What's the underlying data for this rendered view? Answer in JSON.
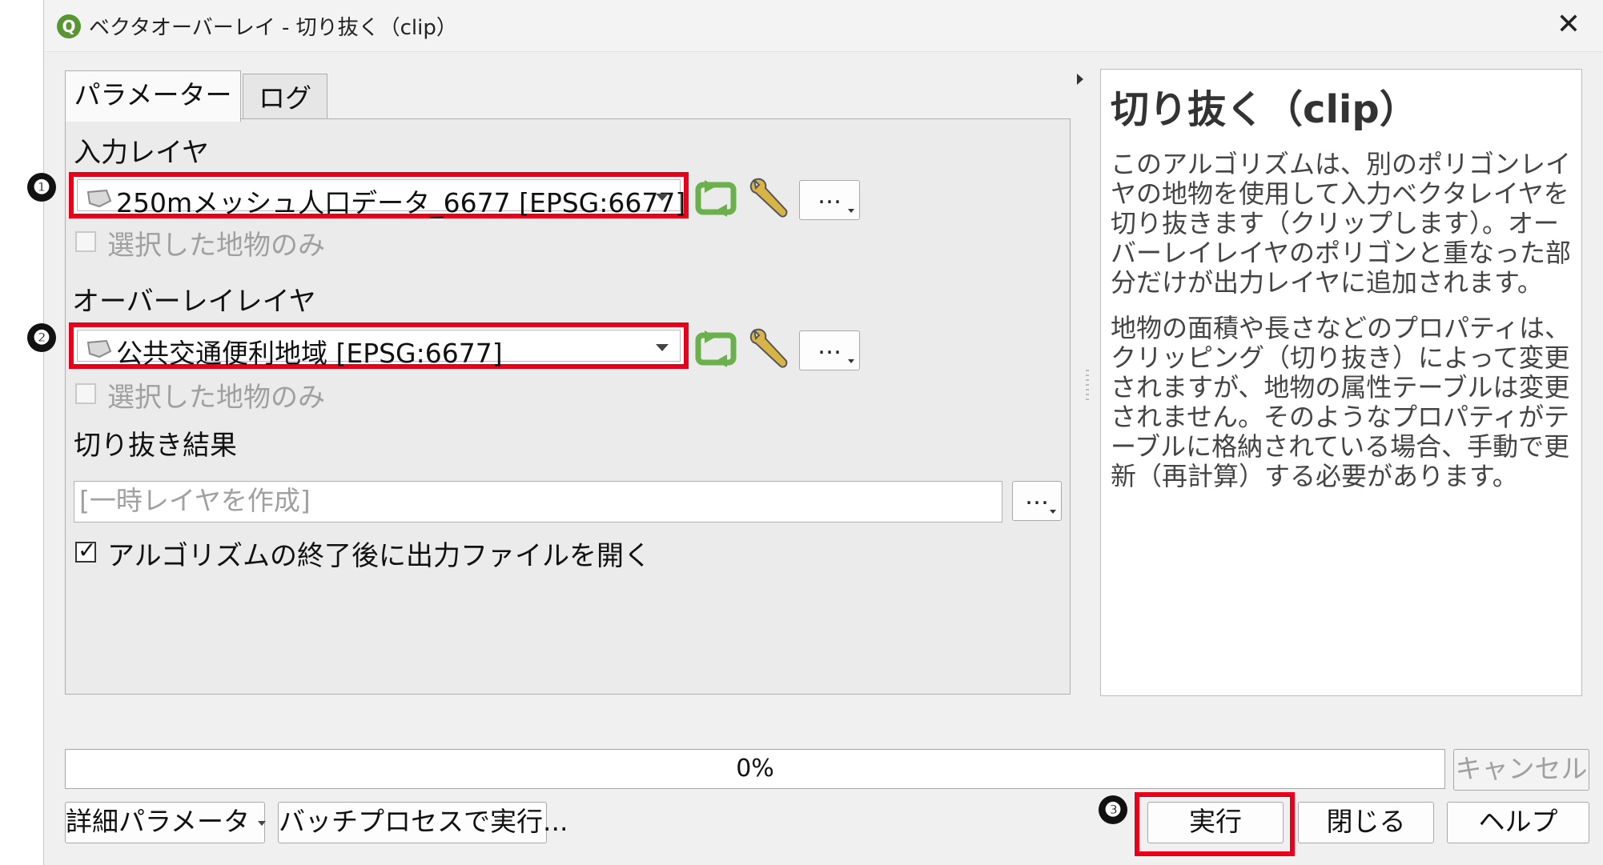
{
  "window": {
    "title": "ベクタオーバーレイ - 切り抜く（clip）",
    "close_glyph": "✕",
    "app_icon_letter": "Q"
  },
  "tabs": [
    {
      "label": "パラメーター",
      "active": true
    },
    {
      "label": "ログ",
      "active": false
    }
  ],
  "params": {
    "input_layer": {
      "label": "入力レイヤ",
      "value": "250mメッシュ人口データ_6677 [EPSG:6677]",
      "selected_only_label": "選択した地物のみ",
      "selected_only_checked": false,
      "more_label": "…"
    },
    "overlay_layer": {
      "label": "オーバーレイレイヤ",
      "value": "公共交通便利地域 [EPSG:6677]",
      "selected_only_label": "選択した地物のみ",
      "selected_only_checked": false,
      "more_label": "…"
    },
    "output": {
      "label": "切り抜き結果",
      "value": "[一時レイヤを作成]",
      "more_label": "…"
    },
    "open_output": {
      "label": "アルゴリズムの終了後に出力ファイルを開く",
      "checked": true
    }
  },
  "help": {
    "title": "切り抜く（clip）",
    "paragraphs": [
      "このアルゴリズムは、別のポリゴンレイヤの地物を使用して入力ベクタレイヤを切り抜きます（クリップします）。オーバーレイレイヤのポリゴンと重なった部分だけが出力レイヤに追加されます。",
      "地物の面積や長さなどのプロパティは、クリッピング（切り抜き）によって変更されますが、地物の属性テーブルは変更されません。そのようなプロパティがテーブルに格納されている場合、手動で更新（再計算）する必要があります。"
    ]
  },
  "progress": {
    "text": "0%",
    "value": 0,
    "cancel_label": "キャンセル"
  },
  "buttons": {
    "advanced": "詳細パラメータ",
    "batch": "バッチプロセスで実行...",
    "run": "実行",
    "close": "閉じる",
    "help": "ヘルプ"
  },
  "markers": [
    "❶",
    "❷",
    "❸"
  ],
  "colors": {
    "highlight": "#e8001b",
    "qgis_green": "#589632",
    "iterate_green": "#6ab04c"
  }
}
